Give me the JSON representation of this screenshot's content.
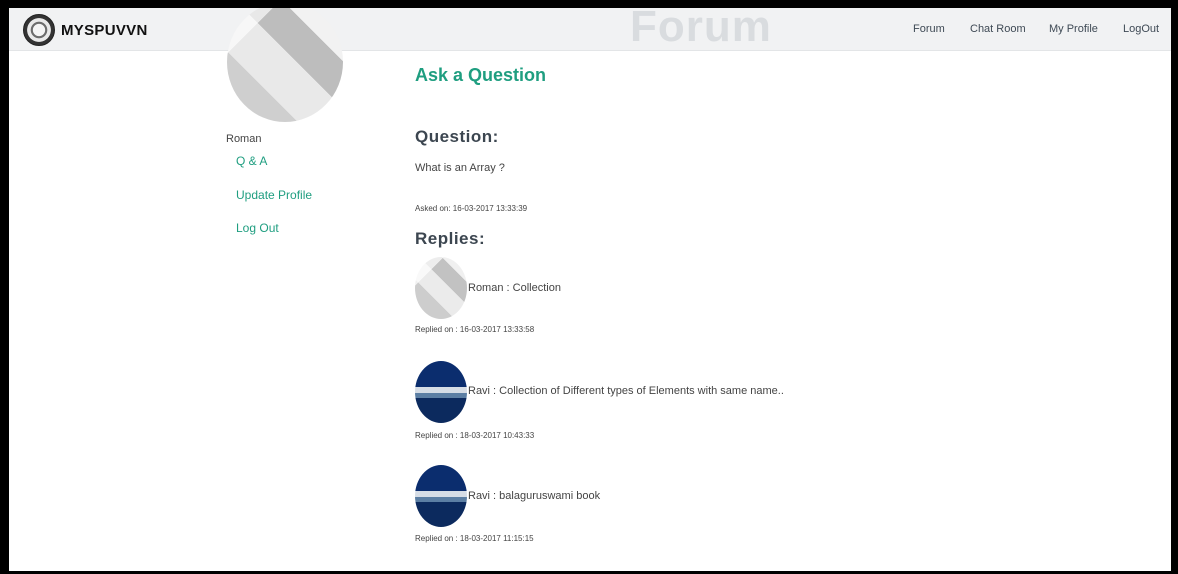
{
  "navbar": {
    "brand": "MYSPUVVN",
    "watermark": "Forum",
    "links": [
      "Forum",
      "Chat Room",
      "My Profile",
      "LogOut"
    ]
  },
  "sidebar": {
    "username": "Roman",
    "links": [
      "Q & A",
      "Update Profile",
      "Log Out"
    ]
  },
  "main": {
    "title": "Ask a Question",
    "question_heading": "Question:",
    "question_text": "What is an Array ?",
    "asked_on": "Asked on: 16-03-2017 13:33:39",
    "replies_heading": "Replies:",
    "replies": [
      {
        "text": "Roman : Collection",
        "date": "Replied on : 16-03-2017 13:33:58",
        "avatar": "gray-avatar"
      },
      {
        "text": "Ravi : Collection of Different types of Elements with same name..",
        "date": "Replied on : 18-03-2017 10:43:33",
        "avatar": "blue-avatar"
      },
      {
        "text": "Ravi : balaguruswami book",
        "date": "Replied on : 18-03-2017 11:15:15",
        "avatar": "blue-avatar"
      }
    ]
  },
  "colors": {
    "accent": "#1f9e80",
    "heading": "#3c4650",
    "navbar_bg": "#f1f2f3"
  }
}
